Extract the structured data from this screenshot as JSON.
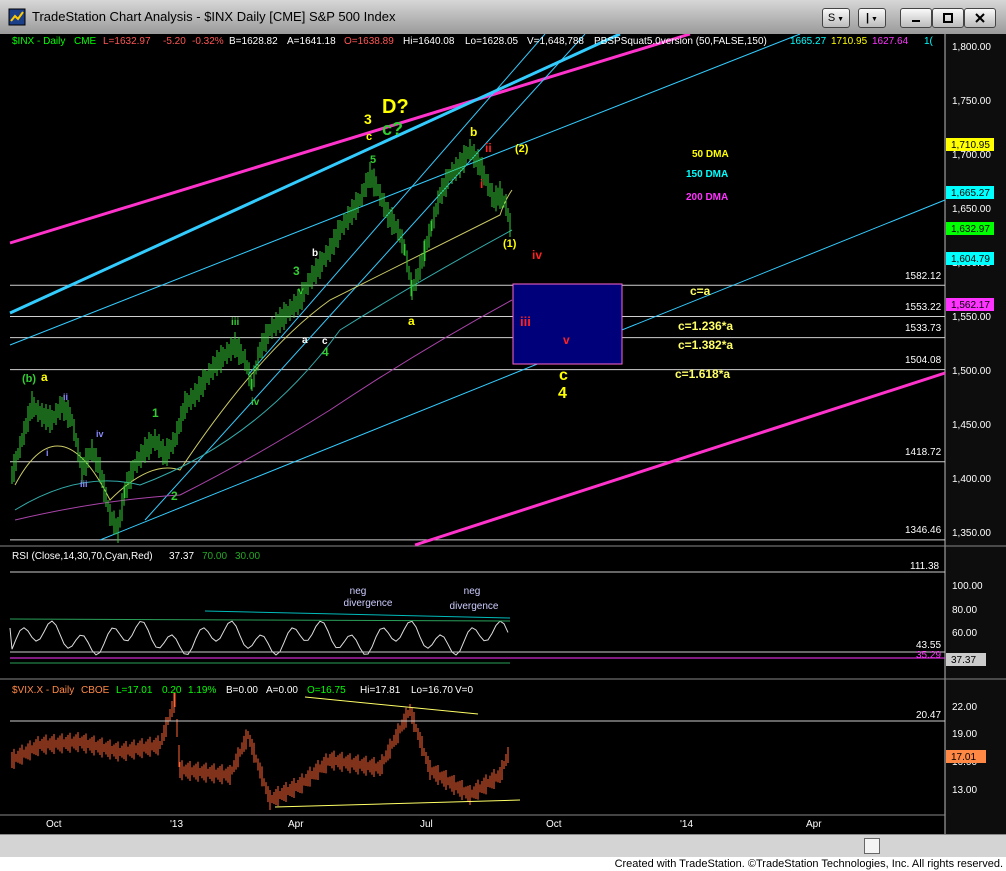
{
  "window": {
    "title": "TradeStation Chart Analysis - $INX Daily [CME] S&P 500 Index",
    "buttons": {
      "s": "S",
      "arrow": "▼"
    }
  },
  "price_pane": {
    "symbol": "$INX - Daily",
    "exchange": "CME",
    "last": "L=1632.97",
    "change": "-5.20",
    "change_pct": "-0.32%",
    "bid": "B=1628.82",
    "ask": "A=1641.18",
    "open": "O=1638.89",
    "high": "Hi=1640.08",
    "low": "Lo=1628.05",
    "volume": "V=1,648,788",
    "indicator": "PBSPSquat5.0version (50,FALSE,150)",
    "ind_vals": [
      "1665.27",
      "1710.95",
      "1627.64",
      "1("
    ],
    "y_ticks": [
      "1,800.00",
      "1,750.00",
      "1,700.00",
      "1,650.00",
      "1,600.00",
      "1,550.00",
      "1,500.00",
      "1,450.00",
      "1,400.00",
      "1,350.00"
    ],
    "price_tags": [
      {
        "text": "1,710.95",
        "color": "#ffff00"
      },
      {
        "text": "1,665.27",
        "color": "#00ffff"
      },
      {
        "text": "1,632.97",
        "color": "#00ff00"
      },
      {
        "text": "1,604.79",
        "color": "#00ffff"
      },
      {
        "text": "1,562.17",
        "color": "#ff00ff"
      }
    ],
    "hlines": [
      "1582.12",
      "1553.22",
      "1533.73",
      "1504.08",
      "1418.72",
      "1346.46"
    ],
    "legend": [
      {
        "text": "50 DMA",
        "color": "#ffff00"
      },
      {
        "text": "150 DMA",
        "color": "#00ffff"
      },
      {
        "text": "200 DMA",
        "color": "#ff00ff"
      }
    ],
    "targets": [
      "c=a",
      "c=1.236*a",
      "c=1.382*a",
      "c=1.618*a"
    ],
    "wave_labels": {
      "d_q": "D?",
      "c_q": "c?",
      "three": "3",
      "c_small": "c",
      "b": "b",
      "ii": "ii",
      "two_p": "(2)",
      "i": "i",
      "one_p": "(1)",
      "iv": "iv",
      "iii": "iii",
      "v": "v",
      "c_big": "c",
      "four": "4",
      "a": "a",
      "b_paren": "(b)",
      "a_small": "a",
      "g_b": "b",
      "g_three": "3",
      "g_v": "v",
      "g_iii": "iii",
      "g_one": "1",
      "g_two": "2",
      "g_four": "4",
      "g_iv": "iv",
      "g_a": "a",
      "g_c": "c",
      "w_ii": "ii",
      "w_i": "i",
      "w_iii": "iii",
      "w_iv": "iv",
      "wave5": "5"
    }
  },
  "rsi_pane": {
    "label": "RSI (Close,14,30,70,Cyan,Red)",
    "value": "37.37",
    "ob": "70.00",
    "os": "30.00",
    "y_ticks": [
      "111.38",
      "100.00",
      "80.00",
      "60.00",
      "43.55",
      "35.29"
    ],
    "tag": "37.37",
    "neg1": "neg",
    "div1": "divergence",
    "neg2": "neg",
    "div2": "divergence"
  },
  "vix_pane": {
    "label": "$VIX.X - Daily",
    "exchange": "CBOE",
    "last": "L=17.01",
    "change": "0.20",
    "change_pct": "1.19%",
    "bid": "B=0.00",
    "ask": "A=0.00",
    "open": "O=16.75",
    "high": "Hi=17.81",
    "low": "Lo=16.70",
    "volume": "V=0",
    "y_ticks": [
      "22.00",
      "20.47",
      "19.00",
      "16.00",
      "13.00"
    ],
    "tag": "17.01"
  },
  "x_axis": [
    "Oct",
    "'13",
    "Apr",
    "Jul",
    "Oct",
    "'14",
    "Apr"
  ],
  "footer": "Created with TradeStation. ©TradeStation Technologies, Inc. All rights reserved.",
  "chart_data": {
    "type": "line",
    "title": "$INX Daily [CME] S&P 500 Index",
    "x": [
      "Oct",
      "'13",
      "Apr",
      "Jul",
      "Oct",
      "'14",
      "Apr"
    ],
    "ylim": [
      1330,
      1815
    ],
    "horizontal_levels": [
      1582.12,
      1553.22,
      1533.73,
      1504.08,
      1418.72,
      1346.46
    ],
    "series": [
      {
        "name": "50 DMA",
        "last": 1710.95
      },
      {
        "name": "150 DMA",
        "last": 1665.27
      },
      {
        "name": "200 DMA",
        "last": 1562.17
      }
    ],
    "target_box": {
      "price_top": 1582,
      "price_bottom": 1505
    }
  }
}
